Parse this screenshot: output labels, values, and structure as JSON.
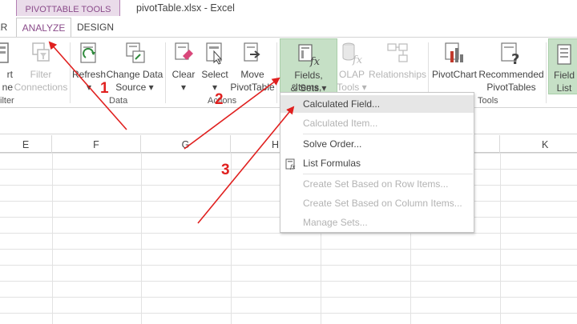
{
  "window": {
    "context_tab": "PIVOTTABLE TOOLS",
    "title": "pivotTable.xlsx - Excel"
  },
  "tabs": {
    "partial": "ER",
    "analyze": "ANALYZE",
    "design": "DESIGN"
  },
  "ribbon": {
    "partial_left": {
      "line1": "rt",
      "line2": "ne"
    },
    "filter_connections": {
      "line1": "Filter",
      "line2": "Connections"
    },
    "filter_group_label": "ilter",
    "refresh": {
      "line1": "Refresh"
    },
    "change_data_source": {
      "line1": "Change Data",
      "line2": "Source"
    },
    "data_group_label": "Data",
    "clear": {
      "line1": "Clear"
    },
    "select": {
      "line1": "Select"
    },
    "move_pivottable": {
      "line1": "Move",
      "line2": "PivotTable"
    },
    "actions_group_label": "Actions",
    "fields_items_sets": {
      "line1": "Fields, Items,",
      "line2": "& Sets"
    },
    "olap_tools": {
      "line1": "OLAP",
      "line2": "Tools"
    },
    "relationships": {
      "line1": "Relationships"
    },
    "pivotchart": {
      "line1": "PivotChart"
    },
    "recommended_pivottables": {
      "line1": "Recommended",
      "line2": "PivotTables"
    },
    "tools_group_label": "Tools",
    "field_list": {
      "line1": "Field",
      "line2": "List"
    }
  },
  "columns": [
    "E",
    "F",
    "G",
    "H",
    "K"
  ],
  "menu": {
    "items": [
      {
        "label": "Calculated Field...",
        "enabled": true,
        "highlighted": true
      },
      {
        "label": "Calculated Item...",
        "enabled": false
      },
      {
        "label": "Solve Order...",
        "enabled": true
      },
      {
        "label": "List Formulas",
        "enabled": true,
        "icon": "list-formulas-icon"
      },
      {
        "label": "Create Set Based on Row Items...",
        "enabled": false
      },
      {
        "label": "Create Set Based on Column Items...",
        "enabled": false
      },
      {
        "label": "Manage Sets...",
        "enabled": false
      }
    ]
  },
  "annotations": [
    "1",
    "2",
    "3"
  ],
  "colors": {
    "accent_purple": "#8a4b8a",
    "context_tab_bg": "#eadcea",
    "highlight_green": "#c6e0c6",
    "annotation_red": "#e0201f"
  }
}
